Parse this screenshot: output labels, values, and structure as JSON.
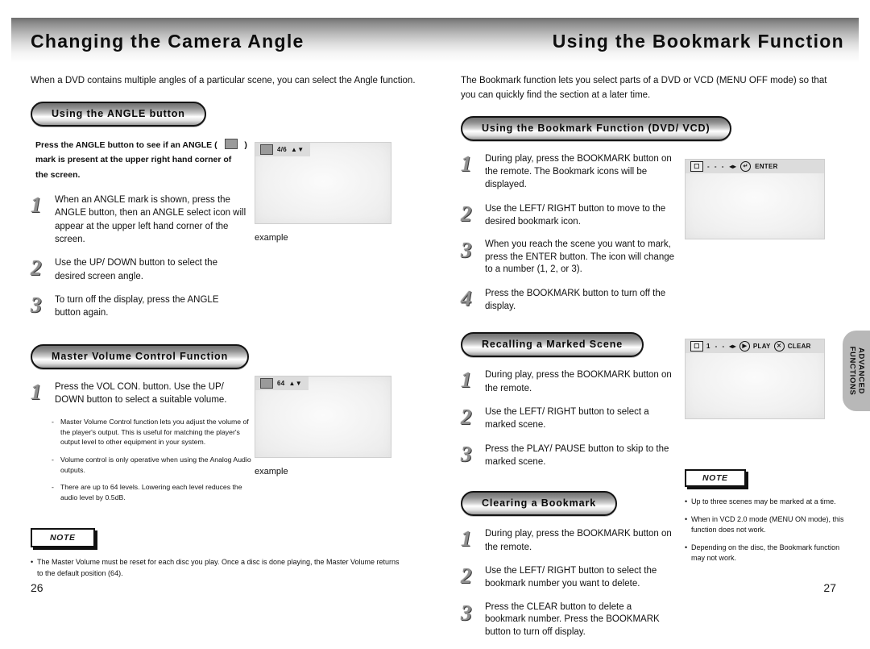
{
  "banner": {
    "left_title": "Changing the Camera Angle",
    "right_title": "Using the Bookmark Function"
  },
  "left_page": {
    "intro": "When a DVD contains multiple angles of a particular scene, you can select the Angle function.",
    "section_angle": {
      "heading": "Using the ANGLE button",
      "bold_line_1": "Press the ANGLE button to see if an ANGLE (",
      "bold_line_1_end": ")",
      "bold_line_2": "mark is present at the upper right hand corner of",
      "bold_line_3": "the screen.",
      "steps": [
        {
          "num": "1",
          "text": "When an ANGLE mark is shown, press the ANGLE button, then an ANGLE select icon will appear at the upper left hand corner of the screen."
        },
        {
          "num": "2",
          "text": "Use the UP/ DOWN button to select the desired screen angle."
        },
        {
          "num": "3",
          "text": "To turn off the display, press the ANGLE button again."
        }
      ],
      "tv": {
        "icon": "angle-camera-icon",
        "value": "4/6",
        "arrows": "updown-arrows-icon"
      },
      "caption": "example"
    },
    "section_volume": {
      "heading": "Master Volume Control Function",
      "steps": [
        {
          "num": "1",
          "text": "Press the VOL CON. button. Use the UP/ DOWN button to select a suitable volume."
        }
      ],
      "subnotes": [
        "Master Volume Control function lets you adjust the volume of the player's output. This is useful for matching the player's output level to other equipment in your system.",
        "Volume control is only operative when using the Analog Audio outputs.",
        "There are up to 64 levels. Lowering each level reduces the audio level by 0.5dB."
      ],
      "tv": {
        "icon": "volume-icon",
        "value": "64",
        "arrows": "updown-arrows-icon"
      },
      "caption": "example"
    },
    "note": {
      "label": "NOTE",
      "items": [
        "The Master Volume must be reset for each disc you play. Once a disc is done playing, the Master Volume returns to the default position (64)."
      ]
    },
    "page_number": "26"
  },
  "right_page": {
    "intro": "The Bookmark function lets you select parts of a DVD or VCD (MENU OFF mode) so that you can quickly find the section at a later time.",
    "section_bookmark": {
      "heading": "Using the Bookmark Function (DVD/ VCD)",
      "steps": [
        {
          "num": "1",
          "text": "During play, press the BOOKMARK button on the remote. The Bookmark icons will be displayed."
        },
        {
          "num": "2",
          "text": "Use the LEFT/ RIGHT button to move to the desired bookmark icon."
        },
        {
          "num": "3",
          "text": "When you reach the scene you want to mark, press the ENTER button. The icon will change to a number (1, 2, or 3)."
        },
        {
          "num": "4",
          "text": "Press the BOOKMARK button to turn off the display."
        }
      ],
      "tv": {
        "icon": "bookmark-icon",
        "marks": "- - -",
        "leftright": "leftright-arrows-icon",
        "enter_icon": "enter-icon",
        "enter_label": "ENTER"
      }
    },
    "section_recall": {
      "heading": "Recalling a Marked Scene",
      "steps": [
        {
          "num": "1",
          "text": "During play, press the BOOKMARK button on the remote."
        },
        {
          "num": "2",
          "text": "Use the LEFT/ RIGHT button to select a marked scene."
        },
        {
          "num": "3",
          "text": "Press the PLAY/ PAUSE button to skip to the marked scene."
        }
      ],
      "tv": {
        "icon": "bookmark-icon",
        "marks": "1 - -",
        "leftright": "leftright-arrows-icon",
        "play_icon": "play-icon",
        "play_label": "PLAY",
        "clear_icon": "clear-icon",
        "clear_label": "CLEAR"
      }
    },
    "section_clear": {
      "heading": "Clearing a Bookmark",
      "steps": [
        {
          "num": "1",
          "text": "During play, press the BOOKMARK button on the remote."
        },
        {
          "num": "2",
          "text": "Use the LEFT/ RIGHT button to select the bookmark number you want to delete."
        },
        {
          "num": "3",
          "text": "Press the CLEAR button to delete a bookmark number. Press the BOOKMARK button to turn off display."
        }
      ]
    },
    "note": {
      "label": "NOTE",
      "items": [
        "Up to three scenes may be marked at a time.",
        "When in VCD 2.0 mode (MENU ON mode), this function does not work.",
        "Depending on the disc, the Bookmark function may not work."
      ]
    },
    "page_number": "27"
  },
  "side_tab": {
    "line1": "ADVANCED",
    "line2": "FUNCTIONS"
  }
}
